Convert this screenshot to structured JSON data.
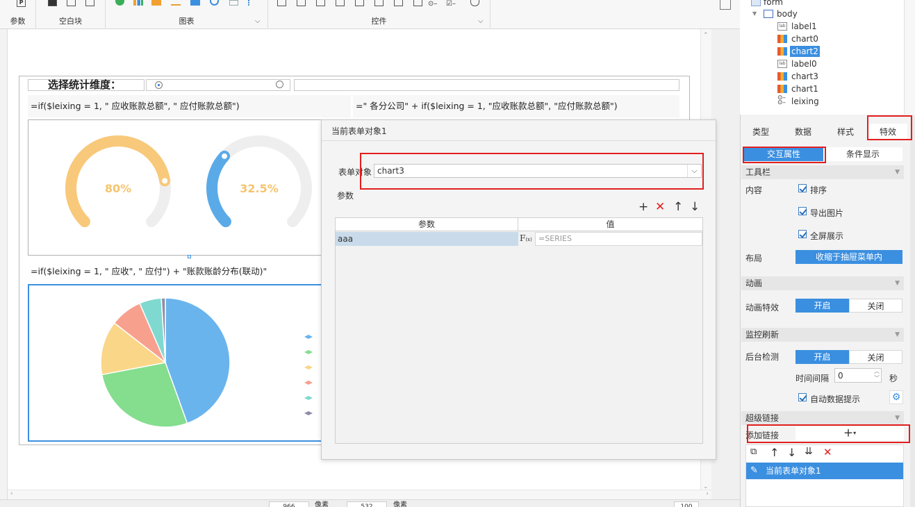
{
  "ribbon": {
    "groups": [
      "参数",
      "空白块",
      "图表",
      "控件"
    ]
  },
  "canvas": {
    "dimension_title": "选择统计维度：",
    "formula_left": "=if($leixing = 1, \" 应收账款总额\", \" 应付账款总额\")",
    "formula_right": "=\" 各分公司\" + if($leixing = 1, \"应收账款总额\", \"应付账款总额\")",
    "formula_pie": "=if($leixing = 1, \" 应收\", \" 应付\") + \"账款账龄分布(联动)\"",
    "gauge1_label": "80%",
    "gauge2_label": "32.5%"
  },
  "chart_data": [
    {
      "type": "gauge",
      "values": [
        80
      ],
      "labels": [
        "80%"
      ],
      "colors": [
        "#f8c97a"
      ]
    },
    {
      "type": "gauge",
      "values": [
        32.5
      ],
      "labels": [
        "32.5%"
      ],
      "colors": [
        "#5aaae8"
      ]
    },
    {
      "type": "pie",
      "values": [
        44.5,
        27.5,
        13.5,
        8,
        5.5,
        1
      ],
      "colors": [
        "#6ab4ee",
        "#84de8e",
        "#fad688",
        "#f7a08e",
        "#80d9d0",
        "#8e8ea8"
      ]
    }
  ],
  "dialog": {
    "title": "当前表单对象1",
    "form_object_label": "表单对象",
    "form_object_value": "chart3",
    "params_label": "参数",
    "col_param": "参数",
    "col_value": "值",
    "row_param": "aaa",
    "row_value_placeholder": "=SERIES"
  },
  "tree": {
    "nodes": [
      "form",
      "body",
      "label1",
      "chart0",
      "chart2",
      "label0",
      "chart3",
      "chart1",
      "leixing"
    ]
  },
  "panel": {
    "tabs": [
      "类型",
      "数据",
      "样式",
      "特效"
    ],
    "subtabs": [
      "交互属性",
      "条件显示"
    ],
    "toolbar_section": "工具栏",
    "content_label": "内容",
    "cb_sort": "排序",
    "cb_export": "导出图片",
    "cb_fullscreen": "全屏展示",
    "layout_label": "布局",
    "layout_value": "收缩于抽屉菜单内",
    "animation_section": "动画",
    "animation_label": "动画特效",
    "on": "开启",
    "off": "关闭",
    "monitor_section": "监控刷新",
    "backend_label": "后台检测",
    "interval_label": "时间间隔",
    "interval_value": "0",
    "seconds": "秒",
    "auto_tip": "自动数据提示",
    "hyperlink_section": "超级链接",
    "add_link_label": "添加链接",
    "link_item": "当前表单对象1"
  },
  "status": {
    "w_value": "966",
    "w_unit": "像素",
    "h_value": "532",
    "h_unit": "像素",
    "zoom": "100"
  },
  "colors": {
    "accent": "#3b8fe0",
    "highlight": "#e31e1e"
  }
}
